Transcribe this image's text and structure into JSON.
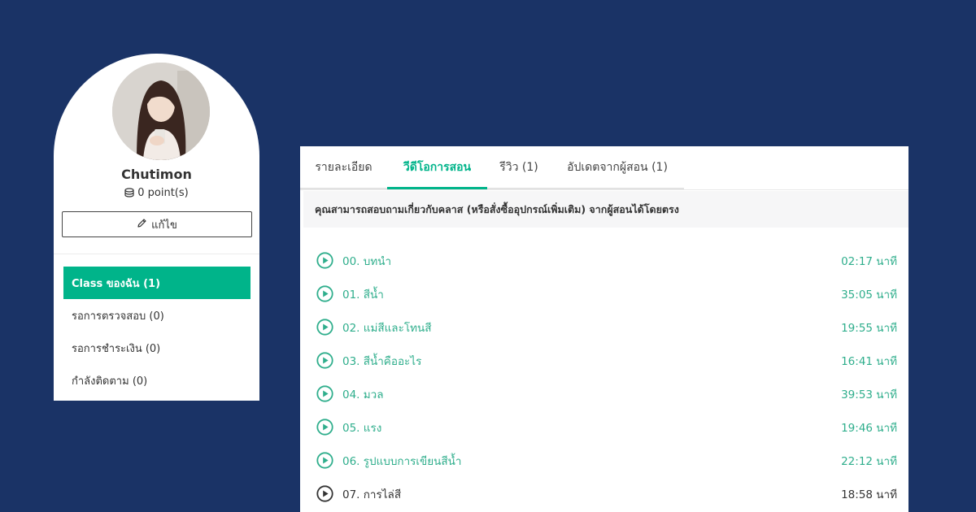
{
  "profile": {
    "name": "Chutimon",
    "points": "0 point(s)",
    "edit_label": "แก้ไข"
  },
  "menu": {
    "items": [
      {
        "label": "Class ของฉัน (1)",
        "active": true
      },
      {
        "label": "รอการตรวจสอบ (0)",
        "active": false
      },
      {
        "label": "รอการชำระเงิน (0)",
        "active": false
      },
      {
        "label": "กำลังติดตาม (0)",
        "active": false
      }
    ]
  },
  "tabs": [
    {
      "label": "รายละเอียด",
      "active": false
    },
    {
      "label": "วีดีโอการสอน",
      "active": true
    },
    {
      "label": "รีวิว (1)",
      "active": false
    },
    {
      "label": "อัปเดตจากผู้สอน (1)",
      "active": false
    }
  ],
  "notice": "คุณสามารถสอบถามเกี่ยวกับคลาส (หรือสั่งซื้ออุปกรณ์เพิ่มเติม) จากผู้สอนได้โดยตรง",
  "videos": [
    {
      "title": "00. บทนำ",
      "duration": "02:17 นาที"
    },
    {
      "title": "01. สีน้ำ",
      "duration": "35:05 นาที"
    },
    {
      "title": "02. แม่สีและโทนสี",
      "duration": "19:55 นาที"
    },
    {
      "title": "03. สีน้ำคืออะไร",
      "duration": "16:41 นาที"
    },
    {
      "title": "04. มวล",
      "duration": "39:53 นาที"
    },
    {
      "title": "05. แรง",
      "duration": "19:46 นาที"
    },
    {
      "title": "06. รูปแบบการเขียนสีน้ำ",
      "duration": "22:12 นาที"
    },
    {
      "title": "07. การไล่สี",
      "duration": "18:58 นาที"
    }
  ],
  "colors": {
    "background": "#1a3366",
    "accent": "#00b48a",
    "video_text": "#2fae8c",
    "text": "#333333"
  },
  "icons": {
    "edit": "pencil-icon",
    "points": "coin-stack-icon",
    "play": "play-circle-icon"
  }
}
